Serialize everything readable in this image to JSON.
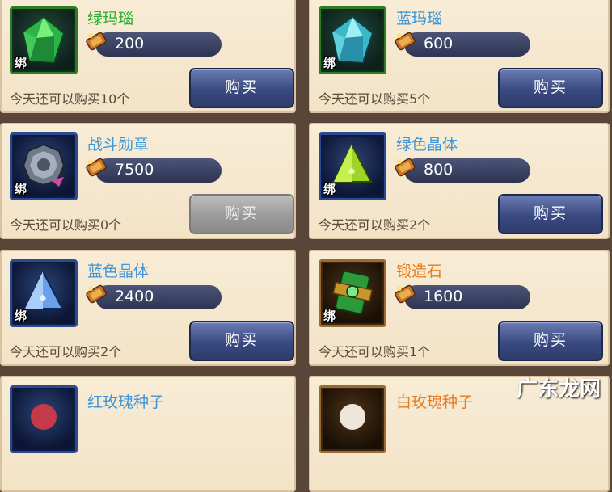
{
  "bind_label": "绑",
  "buy_label": "购买",
  "items": [
    {
      "name": "绿玛瑙",
      "price": "200",
      "limit": "今天还可以购买10个",
      "icon": "green-agate-icon",
      "enabled": true
    },
    {
      "name": "蓝玛瑙",
      "price": "600",
      "limit": "今天还可以购买5个",
      "icon": "blue-agate-icon",
      "enabled": true
    },
    {
      "name": "战斗勋章",
      "price": "7500",
      "limit": "今天还可以购买0个",
      "icon": "battle-medal-icon",
      "enabled": false
    },
    {
      "name": "绿色晶体",
      "price": "800",
      "limit": "今天还可以购买2个",
      "icon": "green-crystal-icon",
      "enabled": true
    },
    {
      "name": "蓝色晶体",
      "price": "2400",
      "limit": "今天还可以购买2个",
      "icon": "blue-crystal-icon",
      "enabled": true
    },
    {
      "name": "锻造石",
      "price": "1600",
      "limit": "今天还可以购买1个",
      "icon": "forging-stone-icon",
      "enabled": true
    },
    {
      "name": "红玫瑰种子",
      "icon": "red-rose-seed-icon"
    },
    {
      "name": "白玫瑰种子",
      "icon": "white-rose-seed-icon"
    }
  ],
  "colors": {
    "name_green": "#28b12a",
    "name_blue": "#3c96d8",
    "name_orange": "#ea7a1e",
    "button": "#3a4a80",
    "button_disabled": "#9a9a9a"
  },
  "watermark": "广东龙网"
}
